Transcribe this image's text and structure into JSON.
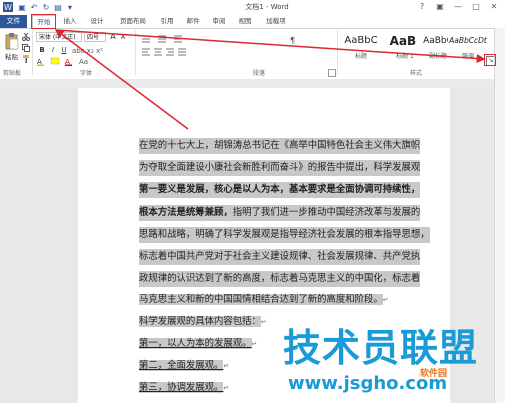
{
  "window": {
    "title": "文档1 - Word"
  },
  "qat": {
    "undo_icon": "↶",
    "redo_icon": "↻",
    "save_icon": "▣",
    "print_icon": "▤",
    "more_icon": "▾"
  },
  "window_buttons": {
    "help": "?",
    "ribbon_display": "▣",
    "minimize": "—",
    "restore": "□",
    "close": "✕"
  },
  "tabs": {
    "file": "文件",
    "items": [
      "开始",
      "插入",
      "设计",
      "页面布局",
      "引用",
      "邮件",
      "审阅",
      "视图",
      "加载项"
    ]
  },
  "ribbon": {
    "clipboard": {
      "paste": "粘贴",
      "label": "剪贴板"
    },
    "font": {
      "name": "宋体 (中文正)",
      "size": "四号",
      "grow": "A",
      "shrink": "A",
      "label": "字体",
      "bold": "B",
      "italic": "I",
      "underline": "U"
    },
    "paragraph": {
      "label": "段落"
    },
    "styles": {
      "label": "样式",
      "items": [
        {
          "sample": "AaBbC",
          "name": "标题"
        },
        {
          "sample": "AaBl",
          "name": "标题 1"
        },
        {
          "sample": "AaBbC",
          "name": "副标题"
        },
        {
          "sample": "AaBbCcDt",
          "name": "强调"
        }
      ]
    }
  },
  "document": {
    "lines": [
      {
        "text": "在党的十七大上，胡锦涛总书记在《高举中国特色社会主义伟大旗帜",
        "bold": false,
        "underline": false
      },
      {
        "text": "为夺取全面建设小康社会新胜利而奋斗》的报告中提出，科学发展观",
        "bold": false,
        "underline": false
      },
      {
        "text": "第一要义是发展，核心是以人为本，基本要求是全面协调可持续性，",
        "bold": true,
        "underline": false
      },
      {
        "text": "根本方法是统筹兼顾，指明了我们进一步推动中国经济改革与发展的",
        "bold": false,
        "underline": false,
        "bold_prefix": "根本方法是统筹兼顾，"
      },
      {
        "text": "思路和战略，明确了科学发展观是指导经济社会发展的根本指导思想，",
        "bold": false,
        "underline": false
      },
      {
        "text": "标志着中国共产党对于社会主义建设规律、社会发展规律、共产党执",
        "bold": false,
        "underline": false
      },
      {
        "text": "政规律的认识达到了新的高度，标志着马克思主义的中国化，标志着",
        "bold": false,
        "underline": false
      },
      {
        "text": "马克思主义和新的中国国情相结合达到了新的高度和阶段。",
        "bold": false,
        "underline": false,
        "mark": "↵"
      },
      {
        "text": "科学发展观的具体内容包括：",
        "bold": false,
        "underline": false,
        "mark": "↵"
      },
      {
        "text": "第一，以人为本的发展观。",
        "bold": false,
        "underline": true,
        "mark": "↵"
      },
      {
        "text": "第二，全面发展观。",
        "bold": false,
        "underline": true,
        "mark": "↵"
      },
      {
        "text": "第三，协调发展观。",
        "bold": false,
        "underline": true,
        "mark": "↵"
      }
    ]
  },
  "watermark": {
    "title": "技术员联盟",
    "url": "www.jsgho.com",
    "sub": "软件园"
  },
  "colors": {
    "accent": "#2b579a",
    "annotation": "#d9282f",
    "highlight": "#c8c8c8",
    "watermark": "#1a9ad6"
  }
}
